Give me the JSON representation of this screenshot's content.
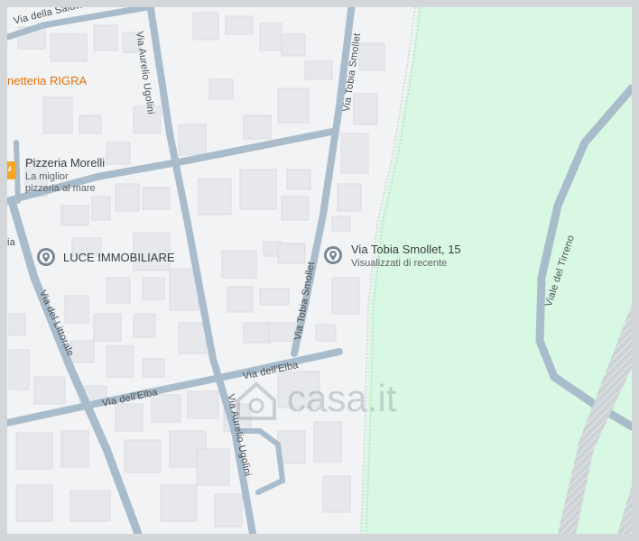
{
  "map": {
    "colors": {
      "background": "#f1f3f4",
      "park": "#d8f8e3",
      "road": "#a9bccb",
      "building": "#e8eaed",
      "rail": "#c9cdd1"
    },
    "pois": {
      "pizzeria_rigra": {
        "name": "netteria RIGRA"
      },
      "pizzeria_morelli": {
        "name": "Pizzeria Morelli",
        "subtitle_line1": "La miglior",
        "subtitle_line2": "pizzeria al mare",
        "icon": "restaurant-icon"
      },
      "luce_immobiliare": {
        "name": "LUCE IMMOBILIARE",
        "icon": "location-pin-icon"
      },
      "selected": {
        "name": "Via Tobia Smollet, 15",
        "subtitle": "Visualizzati di recente",
        "icon": "location-pin-icon"
      }
    },
    "streets": {
      "salute": "Via della Salute",
      "aurelio_ugolini_top": "Via Aurelio Ugolini",
      "tobia_smollet_top": "Via Tobia Smollet",
      "tobia_smollet_bottom": "Via Tobia Smollet",
      "elba_right": "Via dell'Elba",
      "elba_left": "Via dell'Elba",
      "littorale": "Via del Littorale",
      "aurelio_ugolini_bottom": "Via Aurelio Ugolini",
      "tirreno": "Viale del Tirreno",
      "left_edge": "ia"
    },
    "watermark": "casa.it"
  }
}
